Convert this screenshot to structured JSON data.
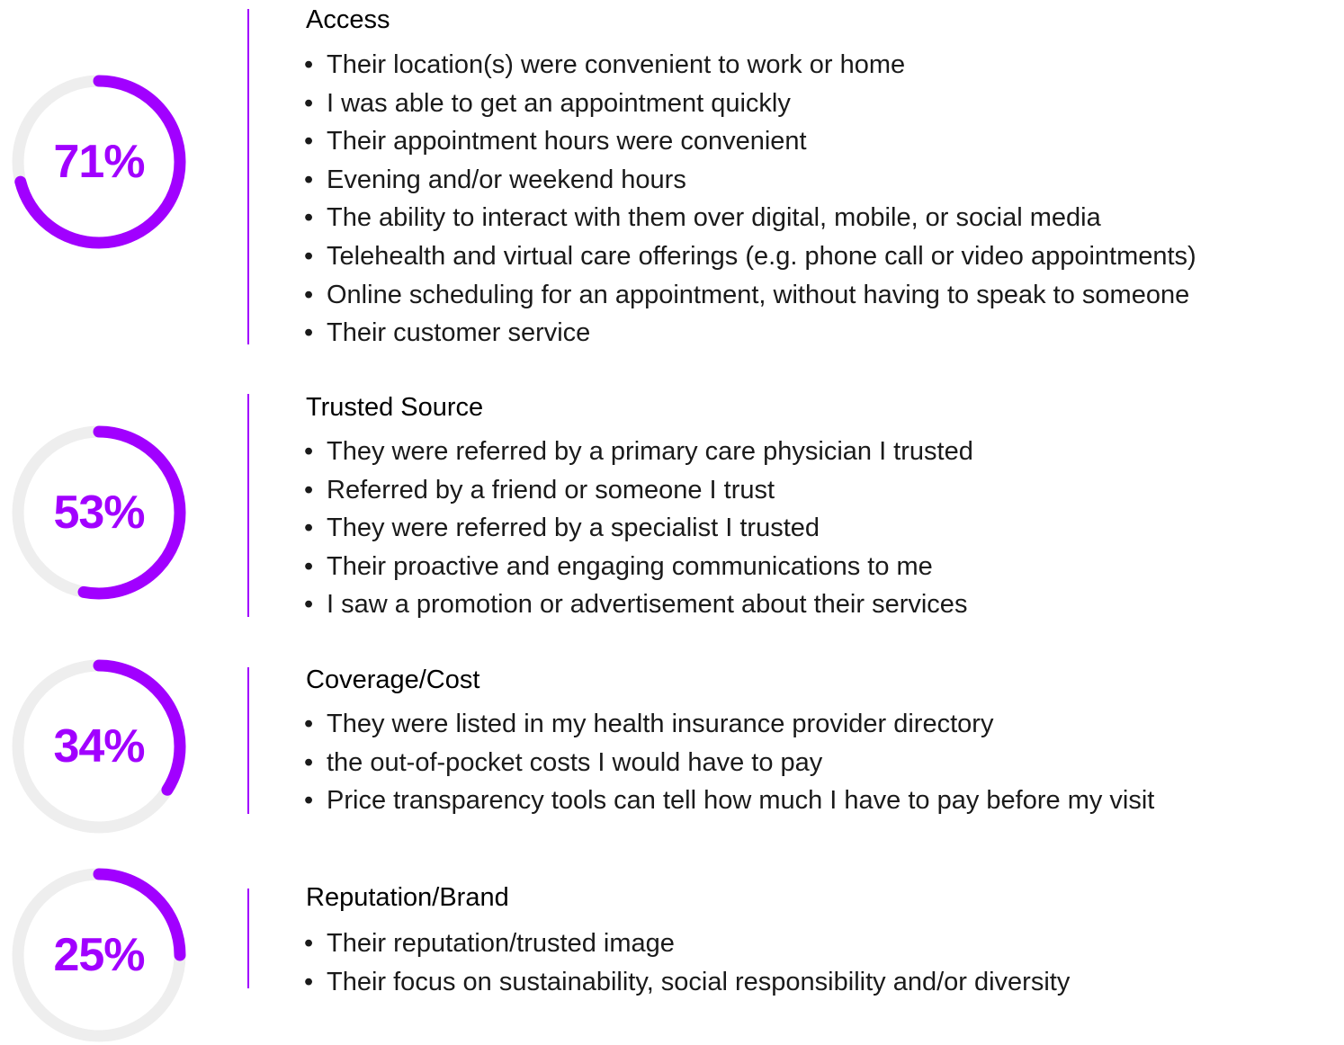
{
  "colors": {
    "accent": "#a100ff",
    "track": "#eeeeee",
    "divider": "#a100ff",
    "text": "#000000"
  },
  "chart_data": {
    "type": "donut",
    "unit": "%",
    "series": [
      {
        "label": "71%",
        "value": 71,
        "category": "Access",
        "items": [
          "Their location(s) were convenient to work or home",
          "I was able to get an appointment quickly",
          "Their appointment hours were convenient",
          "Evening and/or weekend hours",
          "The ability to interact with them over digital, mobile, or social media",
          "Telehealth and virtual care offerings (e.g. phone call or video appointments)",
          "Online scheduling for an appointment, without having to speak to someone",
          "Their customer service"
        ]
      },
      {
        "label": "53%",
        "value": 53,
        "category": "Trusted Source",
        "items": [
          "They were referred by a primary care physician I trusted",
          "Referred by a friend or someone I trust",
          "They were referred by a specialist I trusted",
          "Their proactive and engaging communications to me",
          "I saw a promotion or advertisement about their services"
        ]
      },
      {
        "label": "34%",
        "value": 34,
        "category": "Coverage/Cost",
        "items": [
          "They were listed in my health insurance provider directory",
          "the out-of-pocket costs I would have to pay",
          "Price transparency tools can tell how much I have to pay before my visit"
        ]
      },
      {
        "label": "25%",
        "value": 25,
        "category": "Reputation/Brand",
        "items": [
          "Their reputation/trusted image",
          "Their focus on sustainability, social responsibility and/or diversity"
        ]
      }
    ]
  }
}
